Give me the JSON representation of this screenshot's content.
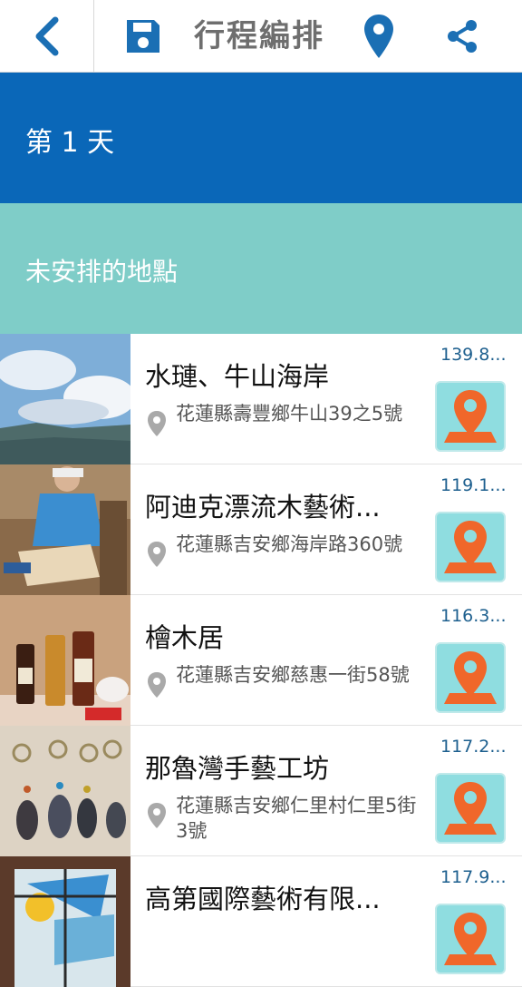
{
  "header": {
    "title": "行程編排",
    "icons": [
      "back-icon",
      "save-icon",
      "location-pin-icon",
      "share-icon"
    ]
  },
  "day_section": {
    "label": "第 1 天",
    "color": "#0a67b8"
  },
  "unplanned_section": {
    "label": "未安排的地點",
    "color": "#7fcdc8"
  },
  "places": [
    {
      "name": "水璉、牛山海岸",
      "address": "花蓮縣壽豐鄉牛山39之5號",
      "distance": "139.8..."
    },
    {
      "name": "阿迪克漂流木藝術...",
      "address": "花蓮縣吉安鄉海岸路360號",
      "distance": "119.1..."
    },
    {
      "name": "檜木居",
      "address": "花蓮縣吉安鄉慈惠一街58號",
      "distance": "116.3..."
    },
    {
      "name": "那魯灣手藝工坊",
      "address": "花蓮縣吉安鄉仁里村仁里5街3號",
      "distance": "117.2..."
    },
    {
      "name": "高第國際藝術有限...",
      "address": "",
      "distance": "117.9..."
    }
  ],
  "colors": {
    "accent": "#0a67b8",
    "pin_orange": "#f0672a",
    "map_button_bg": "#8fdde0",
    "distance_text": "#1d5f8e"
  }
}
